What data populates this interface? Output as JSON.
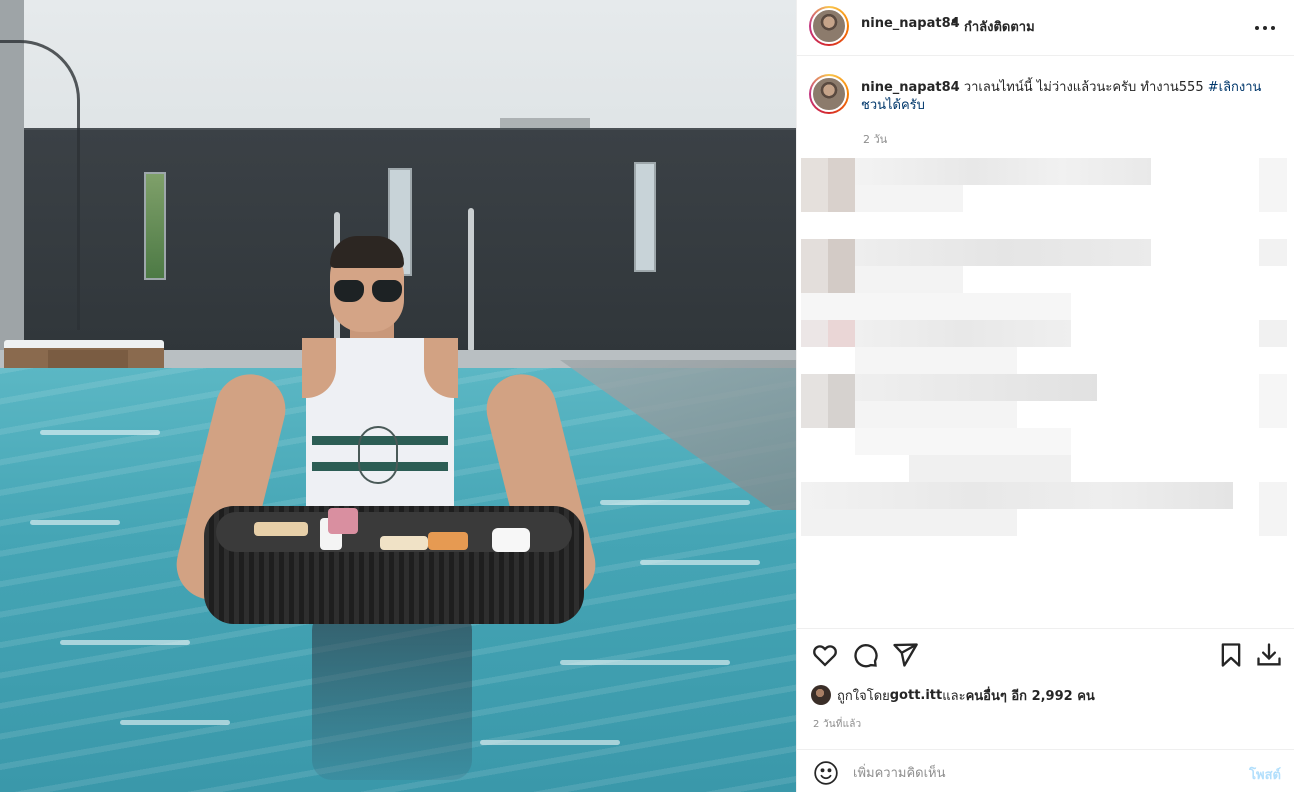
{
  "post": {
    "username": "nine_napat84",
    "separator": "•",
    "follow_status": "กำลังติดตาม",
    "caption": {
      "username": "nine_napat84",
      "text": " วาเลนไทน์นี้ ไม่ว่างแล้วนะครับ ทำงาน555 ",
      "hashtag": "#เลิกงานชวนได้ครับ"
    },
    "caption_time": "2 วัน",
    "likes": {
      "prefix": "ถูกใจโดย ",
      "first_user": "gott.itt",
      "middle": " และ ",
      "others_label": "คนอื่นๆ อีก 2,992 คน"
    },
    "posted_ago": "2 วันที่แล้ว",
    "comment": {
      "placeholder": "เพิ่มความคิดเห็น",
      "post_label": "โพสต์"
    }
  },
  "icons": {
    "more": "more-options-icon",
    "like": "heart-icon",
    "comment": "comment-icon",
    "share": "paper-plane-icon",
    "save": "bookmark-icon",
    "download": "download-icon",
    "emoji": "emoji-icon"
  },
  "colors": {
    "hashtag": "#00376b",
    "secondary_text": "#8e8e8e",
    "post_button_disabled": "#b2dffc",
    "divider": "#efefef"
  }
}
